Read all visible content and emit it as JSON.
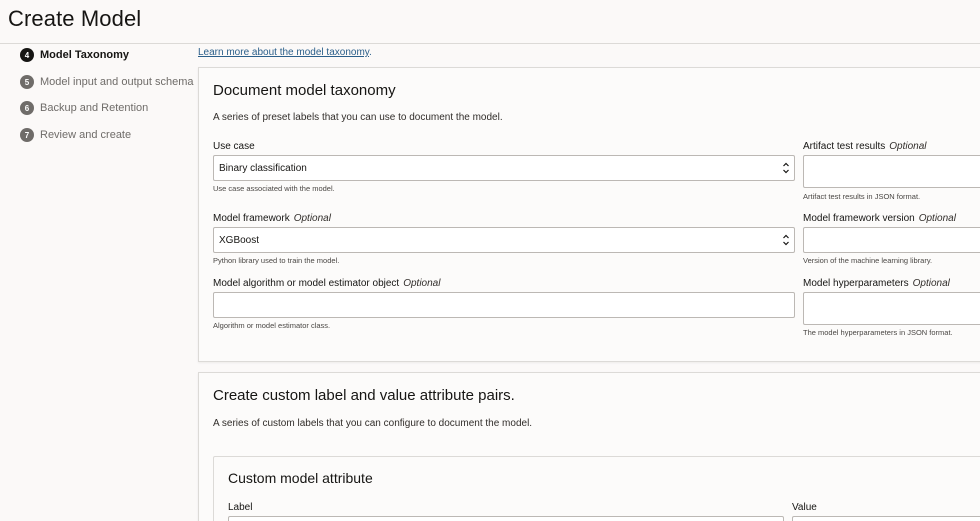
{
  "header": {
    "title": "Create Model"
  },
  "sidebar": {
    "steps": [
      {
        "num": "4",
        "label": "Model Taxonomy"
      },
      {
        "num": "5",
        "label": "Model input and output schema"
      },
      {
        "num": "6",
        "label": "Backup and Retention"
      },
      {
        "num": "7",
        "label": "Review and create"
      }
    ]
  },
  "learn_link": {
    "text": "Learn more about the model taxonomy",
    "suffix": "."
  },
  "taxonomy": {
    "title": "Document model taxonomy",
    "description": "A series of preset labels that you can use to document the model.",
    "use_case": {
      "label": "Use case",
      "value": "Binary classification",
      "help": "Use case associated with the model."
    },
    "framework": {
      "label": "Model framework",
      "optional": "Optional",
      "value": "XGBoost",
      "help": "Python library used to train the model."
    },
    "algorithm": {
      "label": "Model algorithm or model estimator object",
      "optional": "Optional",
      "value": "",
      "help": "Algorithm or model estimator class."
    },
    "artifact": {
      "label": "Artifact test results",
      "optional": "Optional",
      "value": "",
      "help": "Artifact test results in JSON format."
    },
    "framework_version": {
      "label": "Model framework version",
      "optional": "Optional",
      "value": "",
      "help": "Version of the machine learning library."
    },
    "hyperparameters": {
      "label": "Model hyperparameters",
      "optional": "Optional",
      "value": "",
      "help": "The model hyperparameters in JSON format."
    }
  },
  "custom": {
    "title": "Create custom label and value attribute pairs.",
    "description": "A series of custom labels that you can configure to document the model.",
    "attribute": {
      "title": "Custom model attribute",
      "label_label": "Label",
      "value_label": "Value"
    }
  },
  "colors": {
    "link": "#2b5f8a",
    "text": "#161513",
    "muted": "#6f6c69",
    "border": "#dcdad7"
  }
}
